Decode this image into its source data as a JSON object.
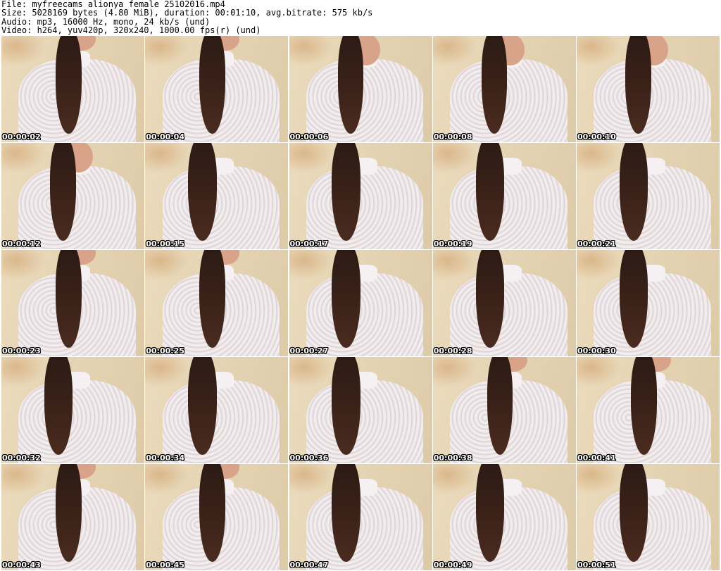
{
  "header": {
    "file": "File: myfreecams_alionya_female_25102016.mp4",
    "size": "Size: 5028169 bytes (4.80 MiB), duration: 00:01:10, avg.bitrate: 575 kb/s",
    "audio": "Audio: mp3, 16000 Hz, mono, 24 kb/s (und)",
    "video": "Video: h264, yuv420p, 320x240, 1000.00 fps(r) (und)"
  },
  "thumbnails": [
    {
      "timestamp": "00:00:02",
      "variant": "v1"
    },
    {
      "timestamp": "00:00:04",
      "variant": "v1"
    },
    {
      "timestamp": "00:00:06",
      "variant": "v2"
    },
    {
      "timestamp": "00:00:08",
      "variant": "v2"
    },
    {
      "timestamp": "00:00:10",
      "variant": "v2"
    },
    {
      "timestamp": "00:00:12",
      "variant": "v2"
    },
    {
      "timestamp": "00:00:15",
      "variant": "v3"
    },
    {
      "timestamp": "00:00:17",
      "variant": "v3"
    },
    {
      "timestamp": "00:00:19",
      "variant": "v3"
    },
    {
      "timestamp": "00:00:21",
      "variant": "v3"
    },
    {
      "timestamp": "00:00:23",
      "variant": "v1"
    },
    {
      "timestamp": "00:00:25",
      "variant": "v1"
    },
    {
      "timestamp": "00:00:27",
      "variant": "v3"
    },
    {
      "timestamp": "00:00:28",
      "variant": "v3"
    },
    {
      "timestamp": "00:00:30",
      "variant": "v3"
    },
    {
      "timestamp": "00:00:32",
      "variant": "v3"
    },
    {
      "timestamp": "00:00:34",
      "variant": "v3"
    },
    {
      "timestamp": "00:00:36",
      "variant": "v3"
    },
    {
      "timestamp": "00:00:38",
      "variant": "v1"
    },
    {
      "timestamp": "00:00:41",
      "variant": "v1"
    },
    {
      "timestamp": "00:00:43",
      "variant": "v1"
    },
    {
      "timestamp": "00:00:45",
      "variant": "v1"
    },
    {
      "timestamp": "00:00:47",
      "variant": "v3"
    },
    {
      "timestamp": "00:00:49",
      "variant": "v3"
    },
    {
      "timestamp": "00:00:51",
      "variant": "v3"
    }
  ]
}
